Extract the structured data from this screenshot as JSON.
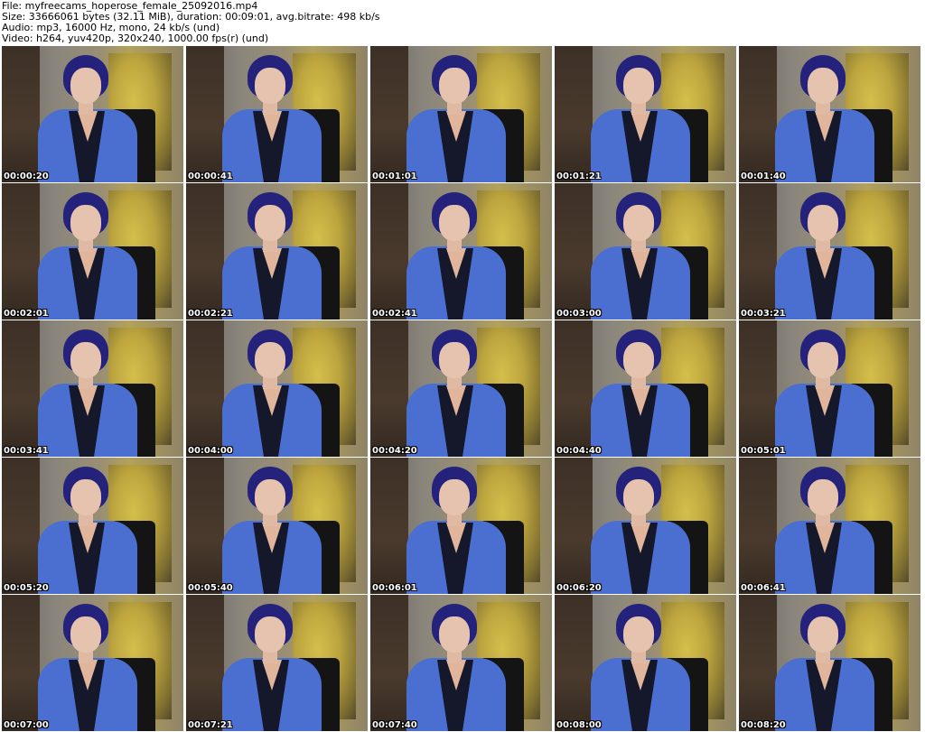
{
  "header": {
    "file": "File: myfreecams_hoperose_female_25092016.mp4",
    "size": "Size: 33666061 bytes (32.11 MiB), duration: 00:09:01, avg.bitrate: 498 kb/s",
    "audio": "Audio: mp3, 16000 Hz, mono, 24 kb/s (und)",
    "video": "Video: h264, yuv420p, 320x240, 1000.00 fps(r) (und)"
  },
  "thumbnails": [
    {
      "time": "00:00:20"
    },
    {
      "time": "00:00:41"
    },
    {
      "time": "00:01:01"
    },
    {
      "time": "00:01:21"
    },
    {
      "time": "00:01:40"
    },
    {
      "time": "00:02:01"
    },
    {
      "time": "00:02:21"
    },
    {
      "time": "00:02:41"
    },
    {
      "time": "00:03:00"
    },
    {
      "time": "00:03:21"
    },
    {
      "time": "00:03:41"
    },
    {
      "time": "00:04:00"
    },
    {
      "time": "00:04:20"
    },
    {
      "time": "00:04:40"
    },
    {
      "time": "00:05:01"
    },
    {
      "time": "00:05:20"
    },
    {
      "time": "00:05:40"
    },
    {
      "time": "00:06:01"
    },
    {
      "time": "00:06:20"
    },
    {
      "time": "00:06:41"
    },
    {
      "time": "00:07:00"
    },
    {
      "time": "00:07:21"
    },
    {
      "time": "00:07:40"
    },
    {
      "time": "00:08:00"
    },
    {
      "time": "00:08:20"
    }
  ],
  "colors": {
    "background": "#ffffff",
    "timestamp_text": "#ffffff",
    "timestamp_outline": "#000000",
    "header_text": "#000000"
  }
}
